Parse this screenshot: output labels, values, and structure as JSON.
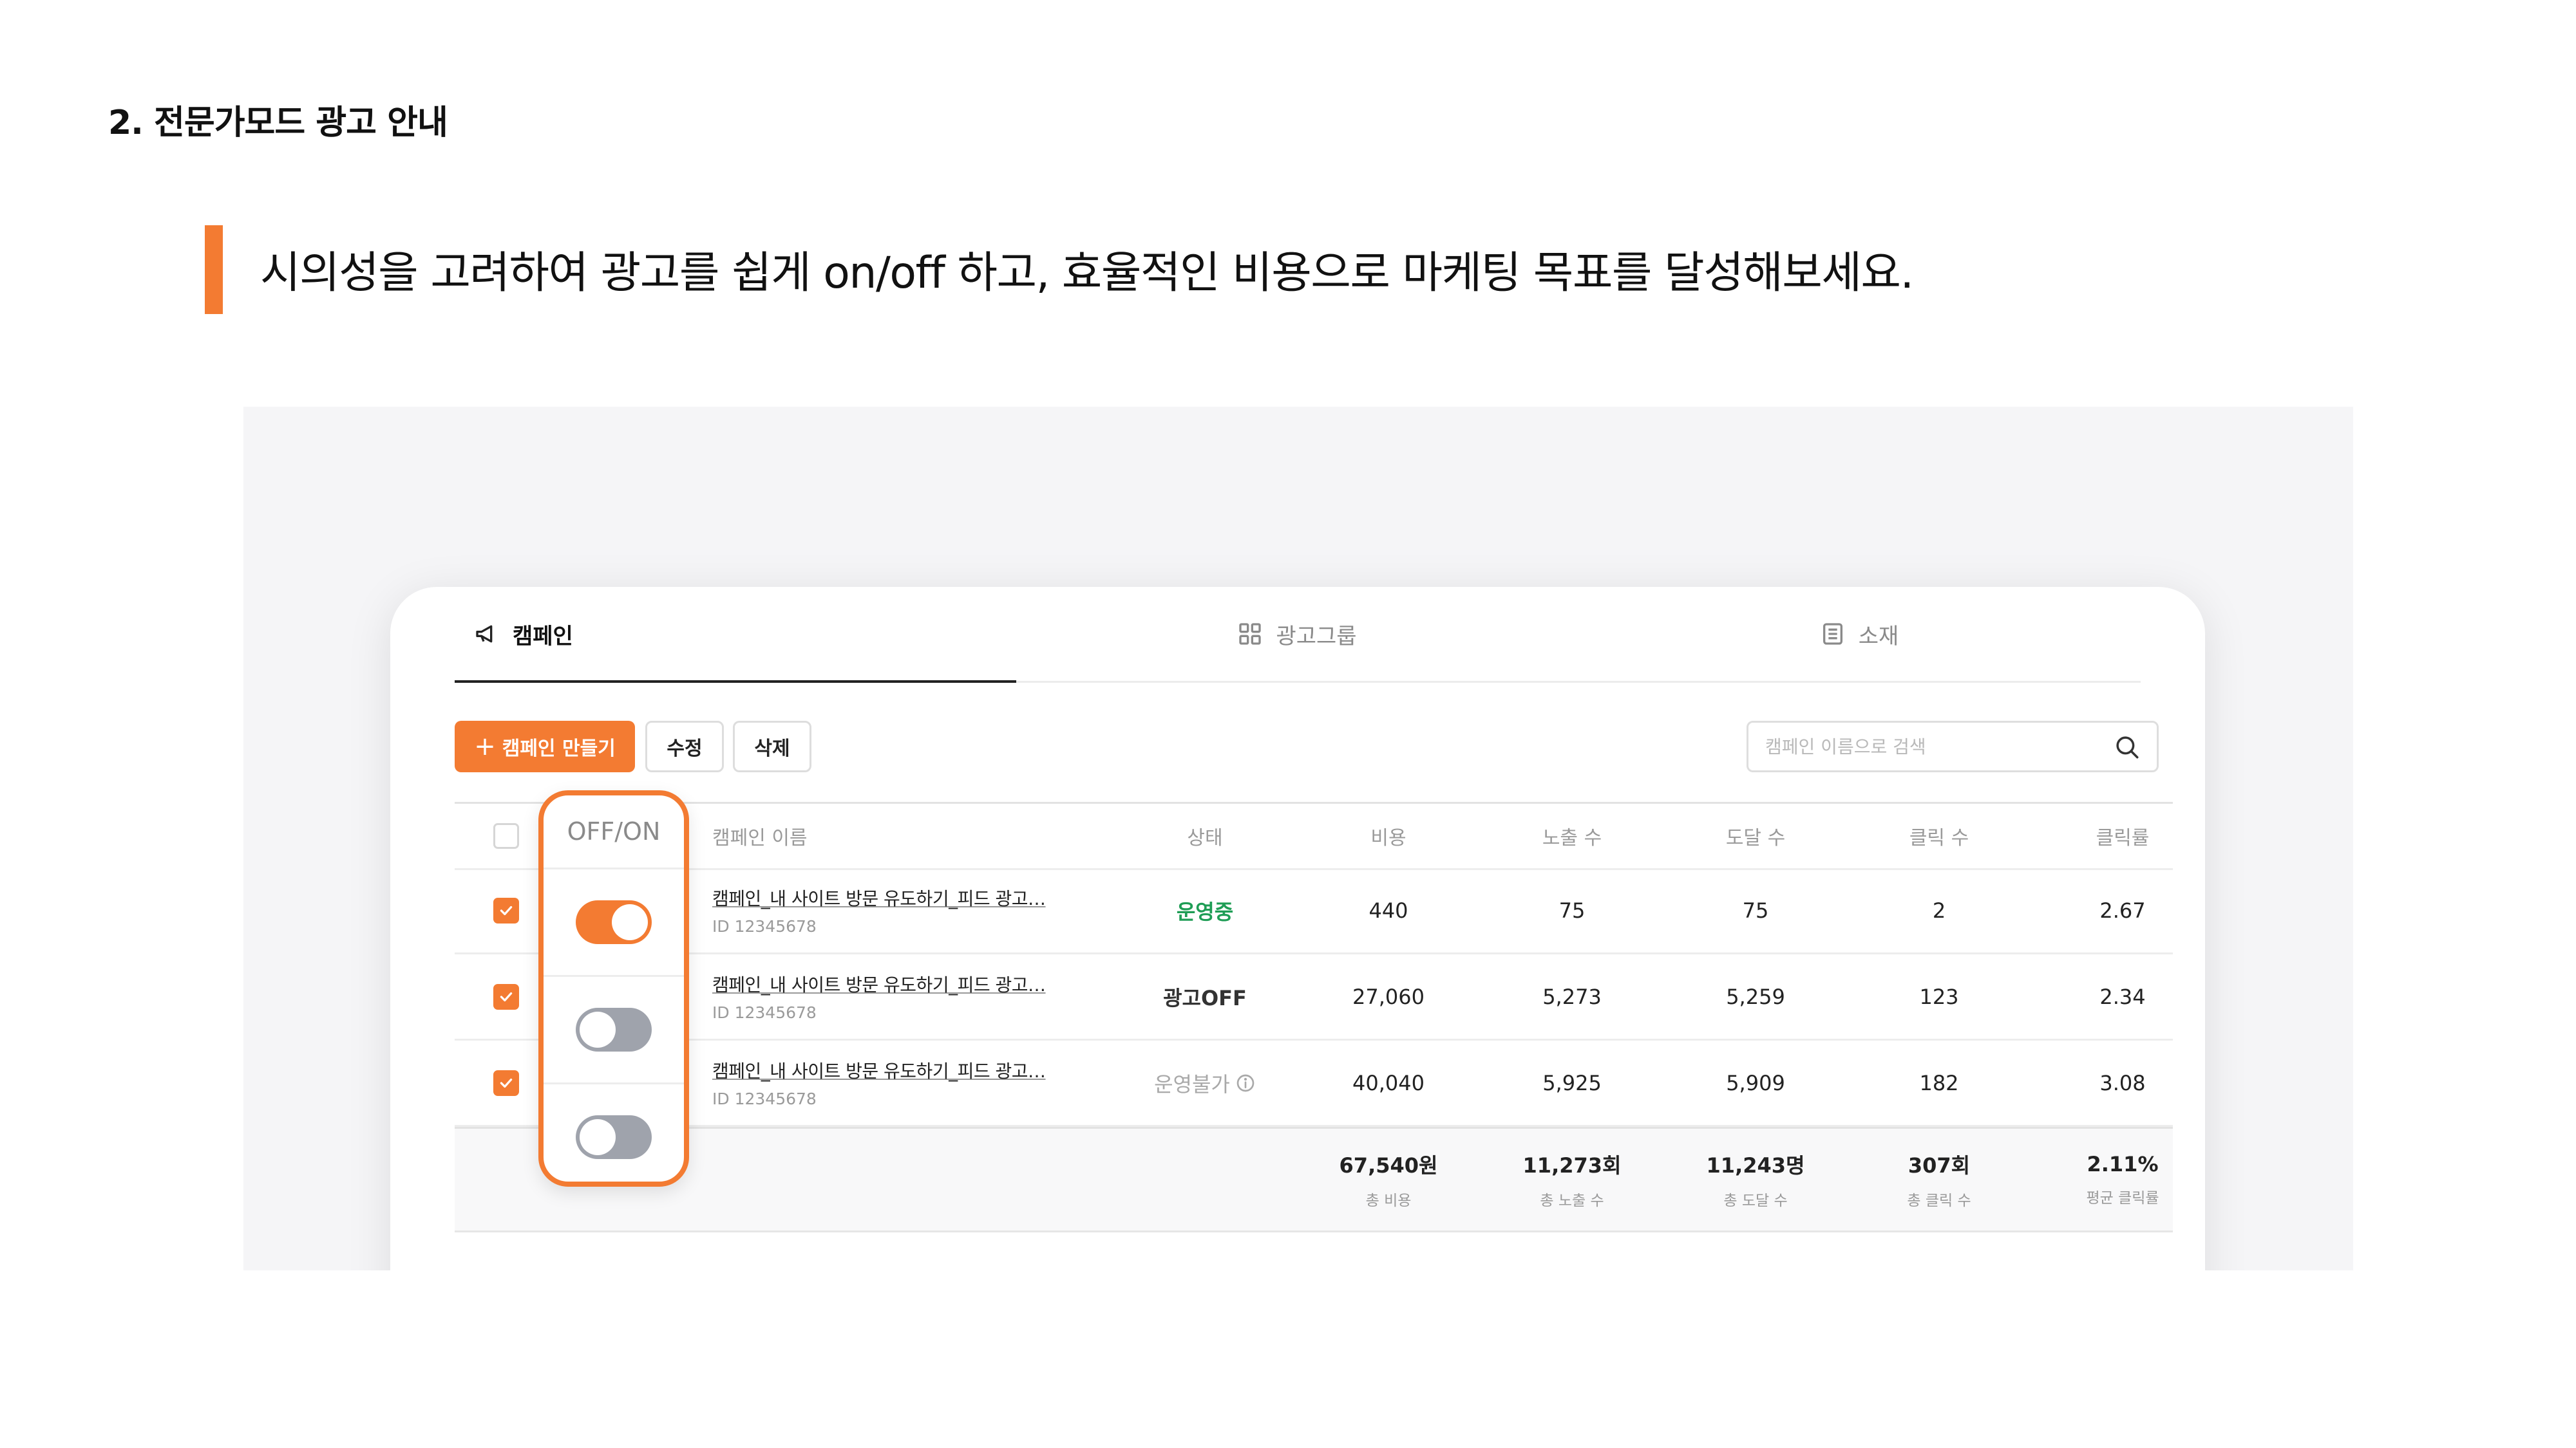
{
  "page": {
    "section_title": "2. 전문가모드 광고 안내",
    "subtitle": "시의성을 고려하여 광고를 쉽게 on/off 하고, 효율적인 비용으로 마케팅 목표를 달성해보세요."
  },
  "colors": {
    "accent": "#f37b32",
    "running": "#1f9d55",
    "toggle_off": "#9fa3ac"
  },
  "tabs": [
    {
      "label": "캠페인",
      "icon": "megaphone-icon",
      "active": true
    },
    {
      "label": "광고그룹",
      "icon": "grid-icon",
      "active": false
    },
    {
      "label": "소재",
      "icon": "list-doc-icon",
      "active": false
    }
  ],
  "toolbar": {
    "create_label": "캠페인 만들기",
    "edit_label": "수정",
    "delete_label": "삭제",
    "search_placeholder": "캠페인 이름으로 검색",
    "search_value": ""
  },
  "table": {
    "toggle_header": "OFF/ON",
    "columns": [
      "캠페인 이름",
      "상태",
      "비용",
      "노출 수",
      "도달 수",
      "클릭 수",
      "클릭률"
    ],
    "rows": [
      {
        "checked": true,
        "toggle_on": true,
        "name": "캠페인_내 사이트 방문 유도하기_피드 광고…",
        "id": "ID 12345678",
        "status": "운영중",
        "cost": "440",
        "impressions": "75",
        "reach": "75",
        "clicks": "2",
        "ctr": "2.67"
      },
      {
        "checked": true,
        "toggle_on": false,
        "name": "캠페인_내 사이트 방문 유도하기_피드 광고…",
        "id": "ID 12345678",
        "status": "광고OFF",
        "cost": "27,060",
        "impressions": "5,273",
        "reach": "5,259",
        "clicks": "123",
        "ctr": "2.34"
      },
      {
        "checked": true,
        "toggle_on": false,
        "name": "캠페인_내 사이트 방문 유도하기_피드 광고…",
        "id": "ID 12345678",
        "status": "운영불가",
        "cost": "40,040",
        "impressions": "5,925",
        "reach": "5,909",
        "clicks": "182",
        "ctr": "3.08"
      }
    ],
    "summary": {
      "cost": {
        "value": "67,540원",
        "label": "총 비용"
      },
      "impressions": {
        "value": "11,273회",
        "label": "총 노출 수"
      },
      "reach": {
        "value": "11,243명",
        "label": "총 도달 수"
      },
      "clicks": {
        "value": "307회",
        "label": "총 클릭 수"
      },
      "ctr": {
        "value": "2.11%",
        "label": "평균 클릭률"
      }
    }
  }
}
